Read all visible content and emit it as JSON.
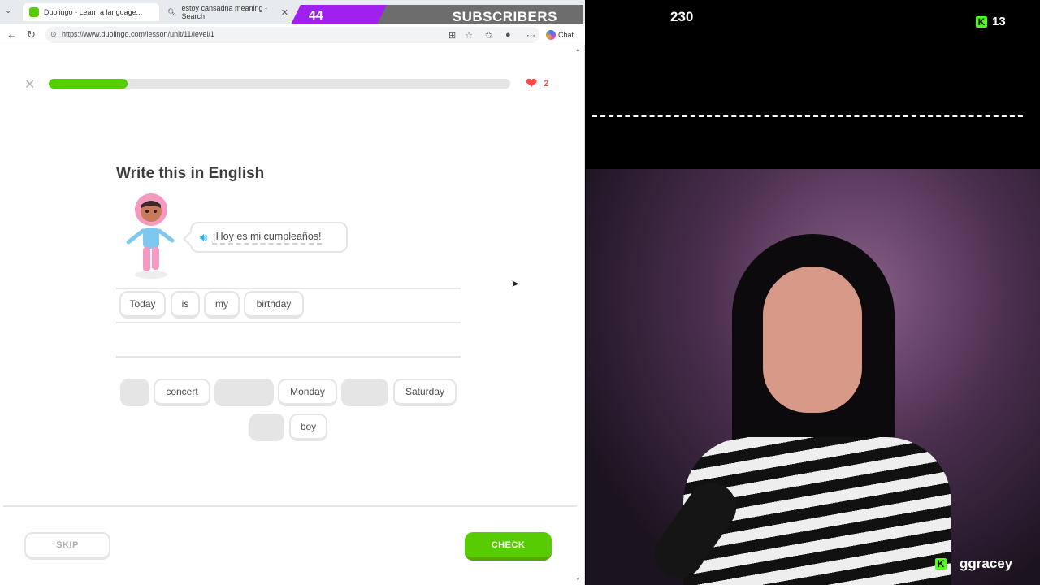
{
  "browser": {
    "tabs": [
      {
        "label": "Duolingo - Learn a language...",
        "active": true
      },
      {
        "label": "estoy cansadna meaning - Search",
        "active": false
      }
    ],
    "url": "https://www.duolingo.com/lesson/unit/11/level/1",
    "chat_label": "Chat"
  },
  "overlay": {
    "subscriber_count": "44",
    "subscriber_label": "SUBSCRIBERS",
    "accent_purple": "#a020f0"
  },
  "lesson": {
    "progress_percent": 17,
    "hearts": "2",
    "prompt_title": "Write this in English",
    "sentence": "¡Hoy es mi cumpleaños!",
    "answer_words": [
      "Today",
      "is",
      "my",
      "birthday"
    ],
    "word_bank": [
      {
        "label": "",
        "used": true
      },
      {
        "label": "concert",
        "used": false
      },
      {
        "label": "",
        "used": true
      },
      {
        "label": "Monday",
        "used": false
      },
      {
        "label": "",
        "used": true
      },
      {
        "label": "Saturday",
        "used": false
      },
      {
        "label": "",
        "used": true
      },
      {
        "label": "boy",
        "used": false
      }
    ],
    "skip_label": "SKIP",
    "check_label": "CHECK",
    "brand_green": "#58cc02"
  },
  "stream": {
    "viewer_count": "230",
    "kick_count": "13",
    "streamer_name": "ggracey",
    "kick_green": "#53fc18"
  }
}
